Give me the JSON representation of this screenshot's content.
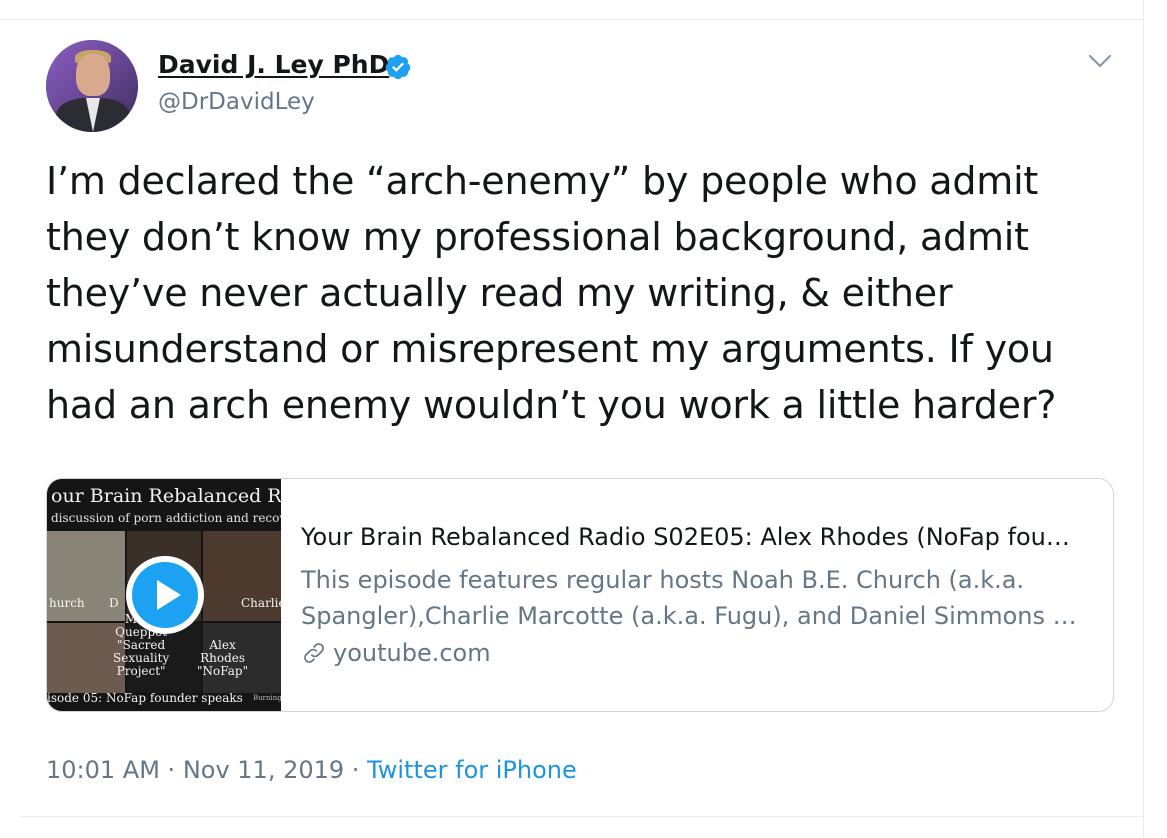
{
  "author": {
    "name": "David J. Ley PhD",
    "handle": "@DrDavidLey",
    "verified": true
  },
  "tweet": {
    "lines": [
      "I’m declared the “arch-enemy” by people who admit",
      "they don’t know my professional background, admit",
      "they’ve never actually read my writing, & either",
      "misunderstand or misrepresent my arguments. If you",
      "had an arch enemy wouldn’t you work a little harder?"
    ]
  },
  "card": {
    "thumbnail": {
      "header_title": "our Brain Rebalanced Radi",
      "header_subtitle": "discussion of porn addiction and recover",
      "labels": {
        "left_name": "hurch",
        "mid_name": "D",
        "right_name": "Charlie",
        "mark": [
          "Mark",
          "Queppet",
          "\"Sacred",
          "Sexuality",
          "Project\""
        ],
        "alex": [
          "Alex",
          "Rhodes",
          "\"NoFap\""
        ]
      },
      "footer": "isode 05: NoFap founder speaks",
      "footer_small": "Burning"
    },
    "title": "Your Brain Rebalanced Radio S02E05: Alex Rhodes (NoFap fou…",
    "description_lines": [
      "This episode features regular hosts Noah B.E. Church (a.k.a.",
      "Spangler),Charlie Marcotte (a.k.a. Fugu), and Daniel Simmons …"
    ],
    "domain": "youtube.com"
  },
  "meta": {
    "time": "10:01 AM",
    "separator": " · ",
    "date": "Nov 11, 2019",
    "source": "Twitter for iPhone"
  },
  "colors": {
    "accent": "#1da1f2",
    "secondary_text": "#657786",
    "primary_text": "#14171a",
    "border": "#ccd6dd"
  }
}
